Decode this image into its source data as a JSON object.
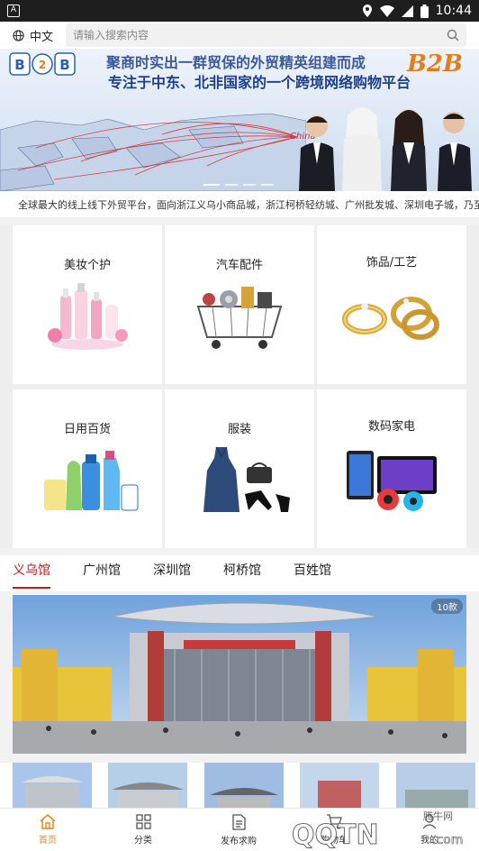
{
  "status_bar": {
    "time": "10:44"
  },
  "header": {
    "lang_label": "中文",
    "search_placeholder": "请输入搜索内容"
  },
  "banner": {
    "headline_top": "聚商时实出一群贸保的外贸精英组建而成",
    "headline": "专注于中东、北非国家的一个跨境网络购物平台",
    "brand": "B2B",
    "logo_letters": [
      "B",
      "2",
      "B"
    ],
    "map_label": "China"
  },
  "notice": {
    "text": "全球最大的线上线下外贸平台，面向浙江义乌小商品城，浙江柯桥轻纺城、广州批发城、深圳电子城，乃至全"
  },
  "categories": [
    {
      "label": "美妆个护",
      "icon": "cosmetics-icon"
    },
    {
      "label": "汽车配件",
      "icon": "auto-parts-icon"
    },
    {
      "label": "饰品/工艺",
      "icon": "rings-icon"
    },
    {
      "label": "日用百货",
      "icon": "detergents-icon"
    },
    {
      "label": "服装",
      "icon": "dress-icon"
    },
    {
      "label": "数码家电",
      "icon": "electronics-icon"
    }
  ],
  "tabs": [
    "义乌馆",
    "广州馆",
    "深圳馆",
    "柯桥馆",
    "百姓馆"
  ],
  "active_tab": "义乌馆",
  "photo_badge": "10款",
  "bottom_nav": [
    {
      "label": "首页",
      "icon": "home-icon",
      "active": true
    },
    {
      "label": "分类",
      "icon": "grid-icon",
      "active": false
    },
    {
      "label": "发布求购",
      "icon": "document-icon",
      "active": false
    },
    {
      "label": "购物车",
      "icon": "cart-icon",
      "active": false
    },
    {
      "label": "我的",
      "icon": "user-icon",
      "active": false
    }
  ],
  "watermark": {
    "site": "腾牛网",
    "brand": "QQTN",
    "suffix": ".com"
  },
  "colors": {
    "accent_red": "#c8161d",
    "nav_active": "#e8861d",
    "banner_blue": "#1c3f8f"
  }
}
